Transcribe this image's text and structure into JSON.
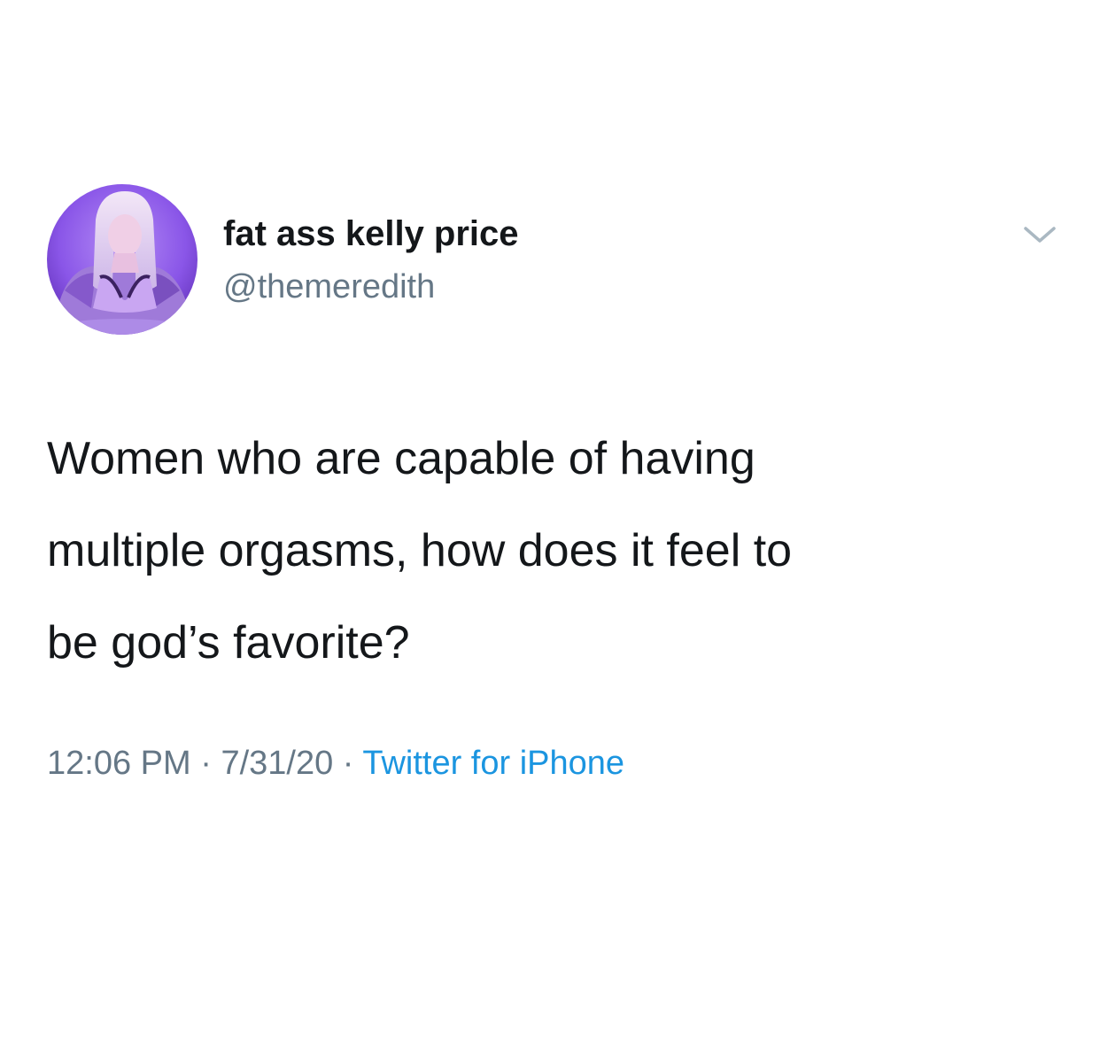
{
  "tweet": {
    "author": {
      "display_name": "fat ass kelly price",
      "handle": "@themeredith"
    },
    "text": "Women who are capable of having\nmultiple orgasms, how does it feel to\nbe god’s favorite?",
    "meta": {
      "time": "12:06 PM",
      "separator": "·",
      "date": "7/31/20",
      "source": "Twitter for iPhone"
    },
    "icons": {
      "avatar": "profile-photo",
      "menu": "chevron-down-icon"
    },
    "colors": {
      "text": "#14171a",
      "secondary": "#657786",
      "link": "#1b95e0",
      "avatar_bg": "#8a56e8"
    }
  }
}
